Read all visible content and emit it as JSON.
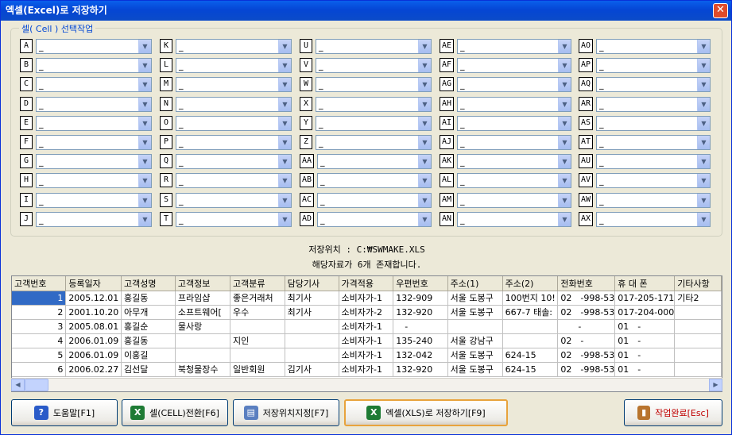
{
  "window": {
    "title": "엑셀(Excel)로 저장하기",
    "close": "✕"
  },
  "group_title": "셀( Cell ) 선택작업",
  "cells": [
    [
      "A",
      "B",
      "C",
      "D",
      "E",
      "F",
      "G",
      "H",
      "I",
      "J"
    ],
    [
      "K",
      "L",
      "M",
      "N",
      "O",
      "P",
      "Q",
      "R",
      "S",
      "T"
    ],
    [
      "U",
      "V",
      "W",
      "X",
      "Y",
      "Z",
      "AA",
      "AB",
      "AC",
      "AD"
    ],
    [
      "AE",
      "AF",
      "AG",
      "AH",
      "AI",
      "AJ",
      "AK",
      "AL",
      "AM",
      "AN"
    ],
    [
      "AO",
      "AP",
      "AQ",
      "AR",
      "AS",
      "AT",
      "AU",
      "AV",
      "AW",
      "AX"
    ]
  ],
  "combo_value": "_",
  "save_location": "저장위치 : C:₩SWMAKE.XLS",
  "record_count": "해당자료가 6개 존재합니다.",
  "table": {
    "headers": [
      "고객번호",
      "등록일자",
      "고객성명",
      "고객정보",
      "고객분류",
      "담당기사",
      "가격적용",
      "우편번호",
      "주소(1)",
      "주소(2)",
      "전화번호",
      "휴 대 폰",
      "기타사항"
    ],
    "rows": [
      [
        "1",
        "2005.12.01",
        "홍길동",
        "프라임샵",
        "좋은거래처",
        "최기사",
        "소비자가-1",
        "132-909",
        "서울 도봉구",
        "100번지 10!",
        "02　-998-53",
        "017-205-171",
        "기타2"
      ],
      [
        "2",
        "2001.10.20",
        "아무개",
        "소프트웨어[",
        "우수",
        "최기사",
        "소비자가-2",
        "132-920",
        "서울 도봉구",
        "667-7 태솔:",
        "02　-998-53",
        "017-204-000",
        ""
      ],
      [
        "3",
        "2005.08.01",
        "홍길순",
        "물사랑",
        "",
        "",
        "소비자가-1",
        "　-",
        "",
        "",
        "　　-",
        "01　-",
        ""
      ],
      [
        "4",
        "2006.01.09",
        "홍길동",
        "",
        "지인",
        "",
        "소비자가-1",
        "135-240",
        "서울 강남구",
        "",
        "02　-",
        "01　-",
        ""
      ],
      [
        "5",
        "2006.01.09",
        "이홍길",
        "",
        "",
        "",
        "소비자가-1",
        "132-042",
        "서울 도봉구",
        "624-15",
        "02　-998-53",
        "01　-",
        ""
      ],
      [
        "6",
        "2006.02.27",
        "김선달",
        "북청물장수",
        "일반회원",
        "김기사",
        "소비자가-1",
        "132-920",
        "서울 도봉구",
        "624-15",
        "02　-998-53",
        "01　-",
        ""
      ]
    ]
  },
  "buttons": {
    "help": "도움말[F1]",
    "cell_convert": "셀(CELL)전환[F6]",
    "save_location": "저장위치지정[F7]",
    "save_excel": "엑셀(XLS)로 저장하기[F9]",
    "done": "작업완료[Esc]"
  },
  "colors": {
    "title_bar": "#0A5FEB",
    "accent": "#0046D5",
    "done_text": "#C00000"
  }
}
